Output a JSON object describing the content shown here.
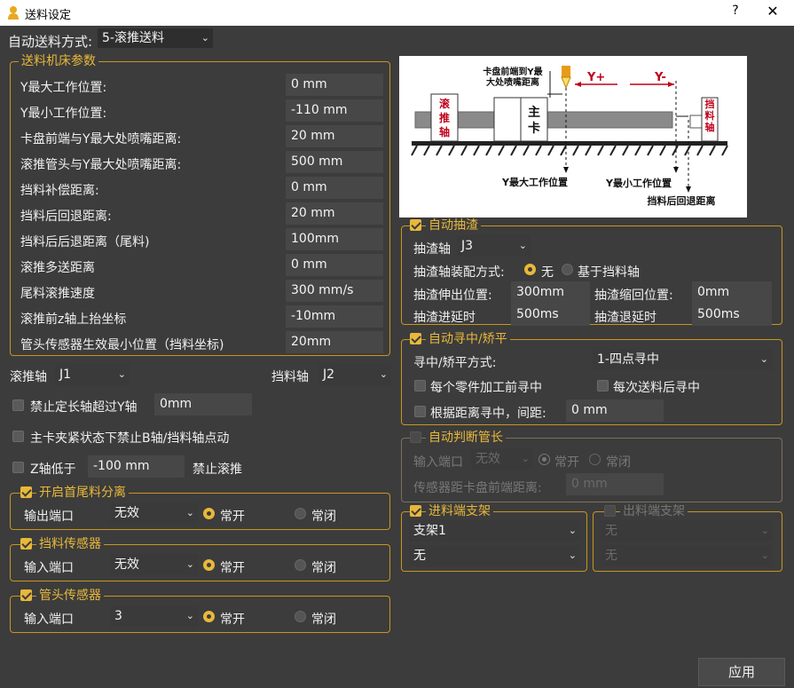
{
  "window": {
    "title": "送料设定",
    "help": "?",
    "close": "✕"
  },
  "auto_feed": {
    "label": "自动送料方式:",
    "value": "5-滚推送料"
  },
  "machine_params": {
    "title": "送料机床参数",
    "rows": [
      {
        "label": "Y最大工作位置:",
        "value": "0 mm"
      },
      {
        "label": "Y最小工作位置:",
        "value": "-110 mm"
      },
      {
        "label": "卡盘前端与Y最大处喷嘴距离:",
        "value": "20 mm"
      },
      {
        "label": "滚推管头与Y最大处喷嘴距离:",
        "value": "500 mm"
      },
      {
        "label": "挡料补偿距离:",
        "value": "0 mm"
      },
      {
        "label": "挡料后回退距离:",
        "value": "20 mm"
      },
      {
        "label": "挡料后后退距离（尾料)",
        "value": "100mm"
      },
      {
        "label": "滚推多送距离",
        "value": "0 mm"
      },
      {
        "label": "尾料滚推速度",
        "value": "300 mm/s"
      },
      {
        "label": "滚推前z轴上抬坐标",
        "value": "-10mm"
      },
      {
        "label": "管头传感器生效最小位置（挡料坐标)",
        "value": "20mm"
      }
    ]
  },
  "axes": {
    "roll_label": "滚推轴",
    "roll_value": "J1",
    "stop_label": "挡料轴",
    "stop_value": "J2"
  },
  "options": {
    "forbid_long_label": "禁止定长轴超过Y轴",
    "forbid_long_value": "0mm",
    "chuck_clamp_label": "主卡夹紧状态下禁止B轴/挡料轴点动",
    "z_low_label": "Z轴低于",
    "z_low_value": "-100 mm",
    "z_low_suffix": "禁止滚推"
  },
  "head_tail": {
    "title": "开启首尾料分离",
    "port_label": "输出端口",
    "port_value": "无效",
    "no_label": "常开",
    "nc_label": "常闭"
  },
  "stop_sensor": {
    "title": "挡料传感器",
    "port_label": "输入端口",
    "port_value": "无效",
    "no_label": "常开",
    "nc_label": "常闭"
  },
  "head_sensor": {
    "title": "管头传感器",
    "port_label": "输入端口",
    "port_value": "3",
    "no_label": "常开",
    "nc_label": "常闭"
  },
  "diagram": {
    "roll_axis": "滚推轴",
    "main_chuck": "主卡",
    "stop_axis": "挡料轴",
    "chuck_to_y_line1": "卡盘前端到Y最",
    "chuck_to_y_line2": "大处喷嘴距离",
    "y_plus": "Y+",
    "y_minus": "Y-",
    "y_max_pos": "Y最大工作位置",
    "y_min_pos": "Y最小工作位置",
    "retreat": "挡料后回退距离",
    "accent": "#c0001a"
  },
  "slag": {
    "title": "自动抽渣",
    "axis_label": "抽渣轴",
    "axis_value": "J3",
    "mount_label": "抽渣轴装配方式:",
    "mount_opt1": "无",
    "mount_opt2": "基于挡料轴",
    "extend_label": "抽渣伸出位置:",
    "extend_value": "300mm",
    "retract_label": "抽渣缩回位置:",
    "retract_value": "0mm",
    "in_delay_label": "抽渣进延时",
    "in_delay_value": "500ms",
    "out_delay_label": "抽渣退延时",
    "out_delay_value": "500ms"
  },
  "centering": {
    "title": "自动寻中/矫平",
    "mode_label": "寻中/矫平方式:",
    "mode_value": "1-四点寻中",
    "each_part_label": "每个零件加工前寻中",
    "each_feed_label": "每次送料后寻中",
    "by_distance_label": "根据距离寻中，间距:",
    "by_distance_value": "0 mm"
  },
  "tube_judge": {
    "title": "自动判断管长",
    "port_label": "输入端口",
    "port_value": "无效",
    "no_label": "常开",
    "nc_label": "常闭",
    "sensor_dist_label": "传感器距卡盘前端距离:",
    "sensor_dist_value": "0 mm"
  },
  "feed_support": {
    "title": "进料端支架",
    "select1": "支架1",
    "select2": "无"
  },
  "out_support": {
    "title": "出料端支架",
    "select1": "无",
    "select2": "无"
  },
  "apply_label": "应用"
}
